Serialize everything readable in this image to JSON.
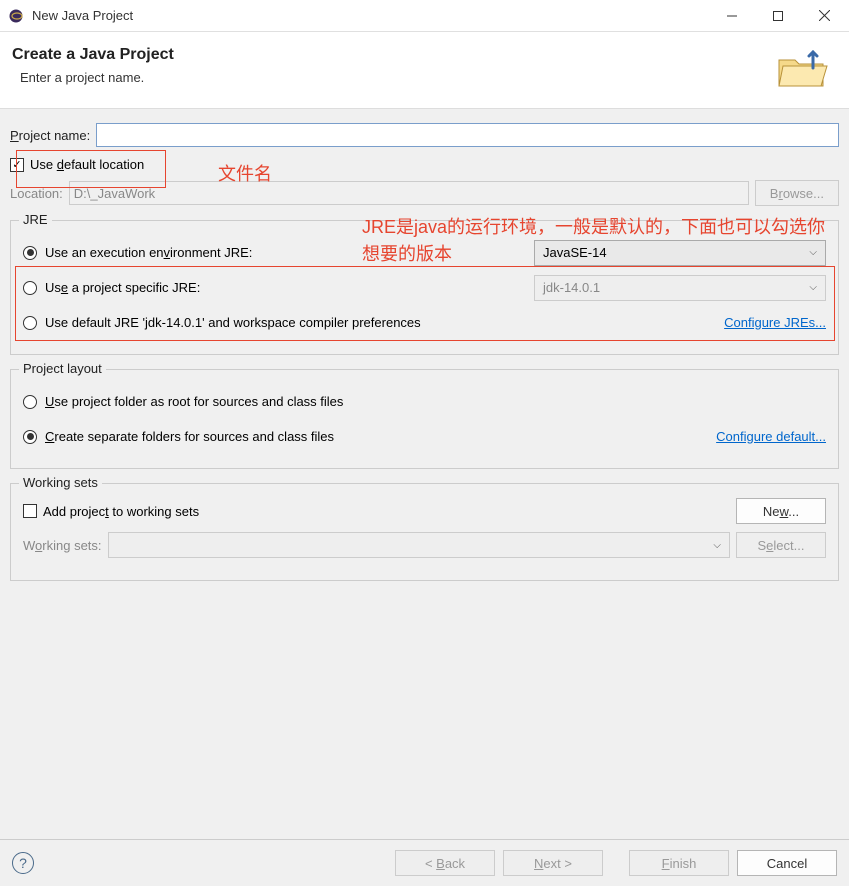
{
  "titlebar": {
    "title": "New Java Project"
  },
  "header": {
    "title": "Create a Java Project",
    "subtitle": "Enter a project name."
  },
  "project_name": {
    "label": "Project name:",
    "value": ""
  },
  "use_default_location": {
    "label": "Use default location",
    "checked": true
  },
  "location": {
    "label": "Location:",
    "value": "D:\\_JavaWork",
    "browse_label": "Browse..."
  },
  "jre": {
    "legend": "JRE",
    "exec_env": {
      "label": "Use an execution environment JRE:",
      "selected": "JavaSE-14"
    },
    "project_specific": {
      "label": "Use a project specific JRE:",
      "selected": "jdk-14.0.1"
    },
    "default": {
      "label": "Use default JRE 'jdk-14.0.1' and workspace compiler preferences"
    },
    "configure_link": "Configure JREs..."
  },
  "project_layout": {
    "legend": "Project layout",
    "root": {
      "label": "Use project folder as root for sources and class files"
    },
    "separate": {
      "label": "Create separate folders for sources and class files"
    },
    "configure_link": "Configure default..."
  },
  "working_sets": {
    "legend": "Working sets",
    "add": {
      "label": "Add project to working sets",
      "checked": false
    },
    "new_btn": "New...",
    "label": "Working sets:",
    "select_btn": "Select..."
  },
  "footer": {
    "back": "< Back",
    "next": "Next >",
    "finish": "Finish",
    "cancel": "Cancel"
  },
  "annotations": {
    "filename": "文件名",
    "jre_note": "JRE是java的运行环境，一般是默认的，下面也可以勾选你想要的版本"
  }
}
